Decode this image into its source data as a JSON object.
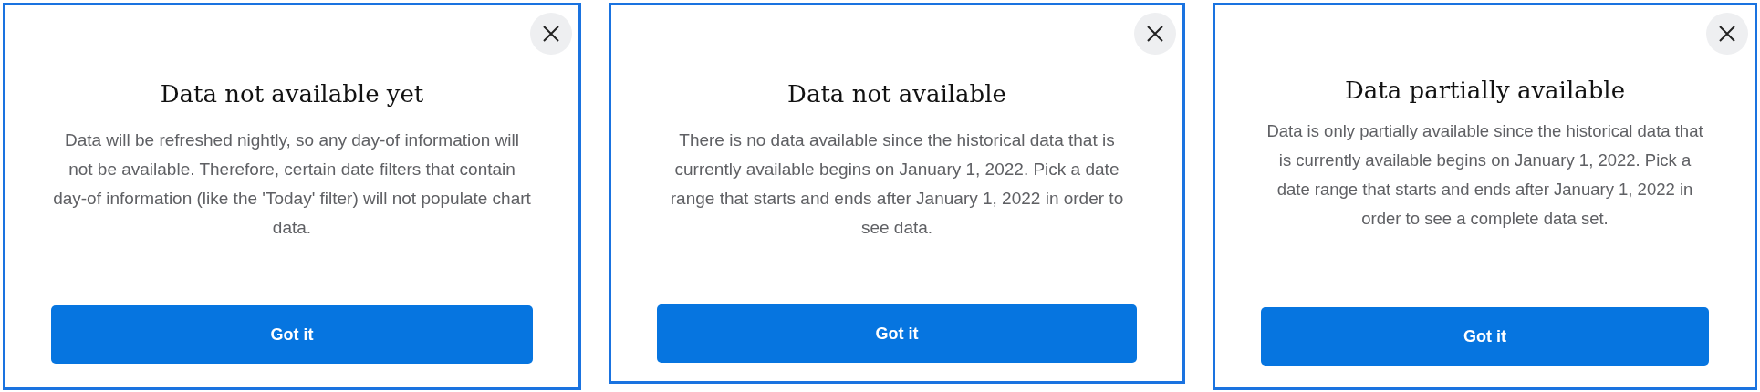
{
  "dialogs": [
    {
      "title": "Data not available yet",
      "message": "Data will be refreshed nightly, so any day-of information will not be available. Therefore, certain date filters that contain day-of information (like the 'Today' filter) will not populate chart data.",
      "button": "Got it"
    },
    {
      "title": "Data not available",
      "message": "There is no data available since the historical data that is currently available begins on January 1, 2022. Pick a date range that starts and ends after January 1, 2022 in order to see data.",
      "button": "Got it"
    },
    {
      "title": "Data partially available",
      "message": "Data is only partially available since the historical data that is currently available begins on January 1, 2022. Pick a date range that starts and ends after January 1, 2022 in order to see a complete data set.",
      "button": "Got it"
    }
  ]
}
